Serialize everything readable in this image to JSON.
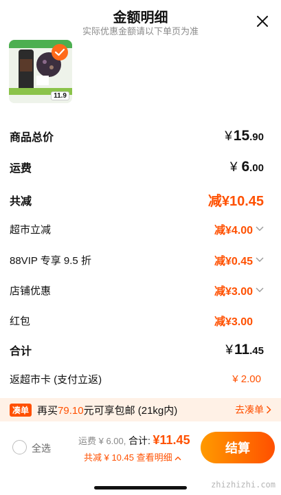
{
  "header": {
    "title": "金额明细",
    "subtitle": "实际优惠金额请以下单页为准"
  },
  "product": {
    "price_tag": "11.9"
  },
  "rows": {
    "goods_total": {
      "label": "商品总价",
      "yen": "¥",
      "int": "15",
      "dec": ".90"
    },
    "shipping": {
      "label": "运费",
      "yen": "¥",
      "int": "6",
      "dec": ".00"
    },
    "total_discount": {
      "label": "共减",
      "value": "减¥10.45"
    },
    "supermarket": {
      "label": "超市立减",
      "value": "减¥4.00"
    },
    "vip": {
      "label": "88VIP 专享 9.5 折",
      "value": "减¥0.45"
    },
    "store": {
      "label": "店铺优惠",
      "value": "减¥3.00"
    },
    "redpack": {
      "label": "红包",
      "value": "减¥3.00"
    },
    "subtotal": {
      "label": "合计",
      "yen": "¥",
      "int": "11",
      "dec": ".45"
    },
    "cashback": {
      "label": "返超市卡 (支付立返)",
      "value": "¥ 2.00"
    }
  },
  "banner": {
    "tag": "凑单",
    "prefix": "再买",
    "amount": "79.10",
    "suffix": "元可享包邮 (21kg内)",
    "link": "去凑单"
  },
  "footer": {
    "select_all": "全选",
    "shipping_text": "运费 ¥ 6.00,",
    "total_label": "合计:",
    "total_value": "¥11.45",
    "discount_text": "共减 ¥ 10.45",
    "detail_link": "查看明细",
    "submit": "结算"
  },
  "watermark": "zhizhizhi.com",
  "colors": {
    "accent": "#ff5000",
    "accent_light": "#ff9a00",
    "banner_bg": "#fff1e6"
  }
}
